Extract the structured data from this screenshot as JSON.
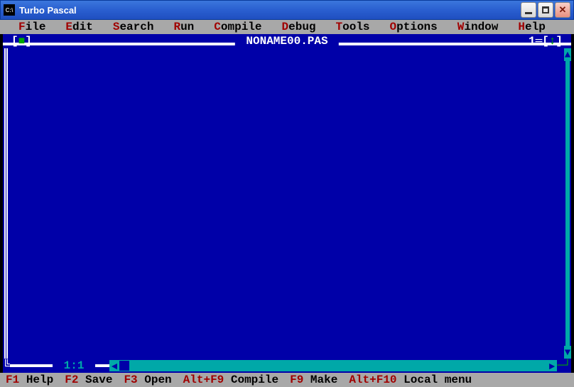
{
  "window": {
    "title": "Turbo Pascal"
  },
  "menu": {
    "items": [
      {
        "hotkey": "F",
        "rest": "ile"
      },
      {
        "hotkey": "E",
        "rest": "dit"
      },
      {
        "hotkey": "S",
        "rest": "earch"
      },
      {
        "hotkey": "R",
        "rest": "un"
      },
      {
        "hotkey": "C",
        "rest": "ompile"
      },
      {
        "hotkey": "D",
        "rest": "ebug"
      },
      {
        "hotkey": "T",
        "rest": "ools"
      },
      {
        "hotkey": "O",
        "rest": "ptions"
      },
      {
        "hotkey": "W",
        "rest": "indow"
      },
      {
        "hotkey": "H",
        "rest": "elp"
      }
    ]
  },
  "editor": {
    "filename": "NONAME00.PAS",
    "window_number": "1",
    "cursor": "1:1"
  },
  "status": {
    "items": [
      {
        "key": "F1",
        "label": "Help"
      },
      {
        "key": "F2",
        "label": "Save"
      },
      {
        "key": "F3",
        "label": "Open"
      },
      {
        "key": "Alt+F9",
        "label": "Compile"
      },
      {
        "key": "F9",
        "label": "Make"
      },
      {
        "key": "Alt+F10",
        "label": "Local menu"
      }
    ]
  }
}
